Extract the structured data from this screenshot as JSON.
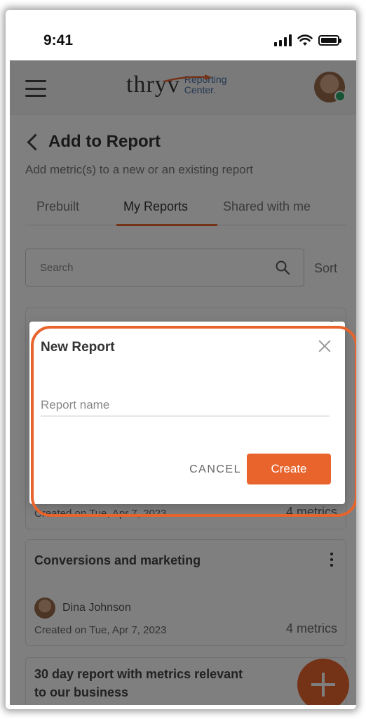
{
  "status_bar": {
    "time": "9:41"
  },
  "header": {
    "logo_word": "thryv",
    "logo_sub_line1": "Reporting",
    "logo_sub_line2": "Center."
  },
  "page": {
    "title": "Add to Report",
    "subtitle": "Add metric(s) to a new or an existing report"
  },
  "tabs": [
    {
      "label": "Prebuilt",
      "active": false
    },
    {
      "label": "My Reports",
      "active": true
    },
    {
      "label": "Shared with me",
      "active": false
    }
  ],
  "search": {
    "placeholder": "Search",
    "sort_label": "Sort"
  },
  "cards": [
    {
      "created": "Created on Tue, Apr 7, 2023",
      "metrics": "4 metrics"
    },
    {
      "title": "Conversions and marketing",
      "owner": "Dina Johnson",
      "created": "Created on Tue, Apr 7, 2023",
      "metrics": "4 metrics"
    },
    {
      "title_line1": "30 day report with metrics relevant",
      "title_line2": "to our business"
    }
  ],
  "dialog": {
    "title": "New Report",
    "input_placeholder": "Report name",
    "cancel_label": "CANCEL",
    "create_label": "Create"
  },
  "colors": {
    "accent": "#e8642c",
    "brand_blue": "#4a6fa5",
    "online": "#2fa86a"
  }
}
